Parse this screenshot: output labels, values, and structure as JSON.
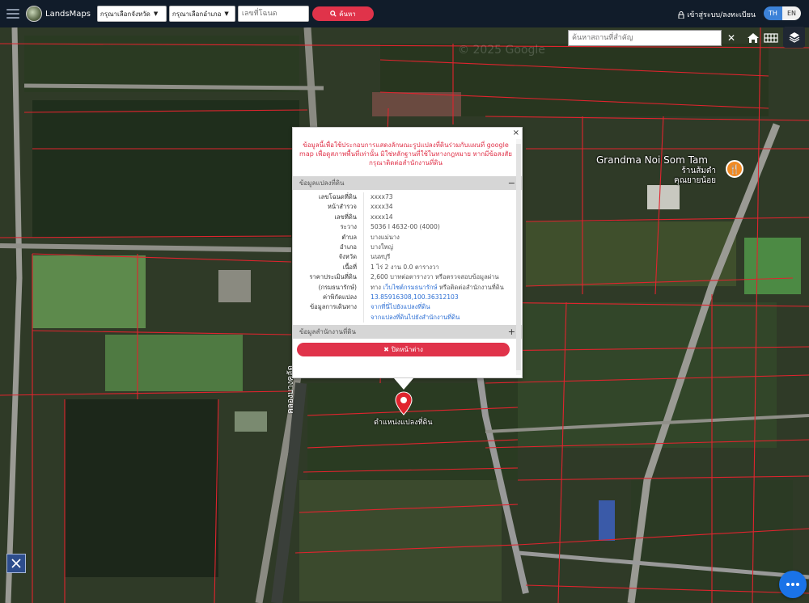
{
  "header": {
    "brand": "LandsMaps",
    "province_select": "กรุณาเลือกจังหวัด",
    "district_select": "กรุณาเลือกอำเภอ",
    "parcel_placeholder": "เลขที่โฉนด",
    "search_label": "ค้นหา",
    "login_label": "เข้าสู่ระบบ/ลงทะเบียน",
    "lang_th": "TH",
    "lang_en": "EN"
  },
  "map": {
    "place_search_placeholder": "ค้นหาสถานที่สำคัญ",
    "clear_label": "✕",
    "watermark": "© 2025 Google",
    "poi_name": "Grandma Noi Som Tam",
    "poi_name_th_1": "ร้านส้มตำ",
    "poi_name_th_2": "คุณยายน้อย",
    "canal_label": "คลองบางคูลัด",
    "pin_label": "ตำแหน่งแปลงที่ดิน"
  },
  "popup": {
    "close_x": "×",
    "notice": "ข้อมูลนี้เพื่อใช้ประกอบการแสดงลักษณะรูปแปลงที่ดินร่วมกับแผนที่ google map เพื่อดูสภาพพื้นที่เท่านั้น มิใช่หลักฐานที่ใช้ในทางกฎหมาย หากมีข้อสงสัย กรุณาติดต่อสำนักงานที่ดิน",
    "section1_title": "ข้อมูลแปลงที่ดิน",
    "section1_toggle": "−",
    "rows": [
      {
        "key": "เลขโฉนดที่ดิน",
        "value": "xxxx73"
      },
      {
        "key": "หน้าสำรวจ",
        "value": "xxxx34"
      },
      {
        "key": "เลขที่ดิน",
        "value": "xxxx14"
      },
      {
        "key": "ระวาง",
        "value": "5036 I 4632-00 (4000)"
      },
      {
        "key": "ตำบล",
        "value": "บางแม่นาง"
      },
      {
        "key": "อำเภอ",
        "value": "บางใหญ่"
      },
      {
        "key": "จังหวัด",
        "value": "นนทบุรี"
      },
      {
        "key": "เนื้อที่",
        "value": "1 ไร่ 2 งาน 0.0 ตารางวา"
      }
    ],
    "price_key_1": "ราคาประเมินที่ดิน",
    "price_key_2": "(กรมธนารักษ์)",
    "price_value_1": "2,600 บาทต่อตารางวา หรือตรวจสอบข้อมูลผ่าน",
    "price_value_2_prefix": "ทาง",
    "price_value_2_link": "เว็บไซต์กรมธนารักษ์",
    "price_value_2_suffix": "หรือติดต่อสำนักงานที่ดิน",
    "coord_key": "ค่าพิกัดแปลง",
    "coord_value": "13.85916308,100.36312103",
    "route_key": "ข้อมูลการเดินทาง",
    "route_link_1": "จากที่นี่ไปยังแปลงที่ดิน",
    "route_link_2": "จากแปลงที่ดินไปยังสำนักงานที่ดิน",
    "section2_title": "ข้อมูลสำนักงานที่ดิน",
    "section2_toggle": "+",
    "close_window_label": "ปิดหน้าต่าง"
  },
  "colors": {
    "accent_red": "#e0334a",
    "topbar": "#111c2a",
    "parcel_line": "#e0242e",
    "lang_active": "#3c82d8"
  },
  "icons": [
    "menu-icon",
    "search-icon",
    "lock-icon",
    "home-icon",
    "grid-icon",
    "layers-icon",
    "close-icon",
    "map-pin-icon",
    "tools-icon",
    "chat-icon",
    "restaurant-icon"
  ]
}
